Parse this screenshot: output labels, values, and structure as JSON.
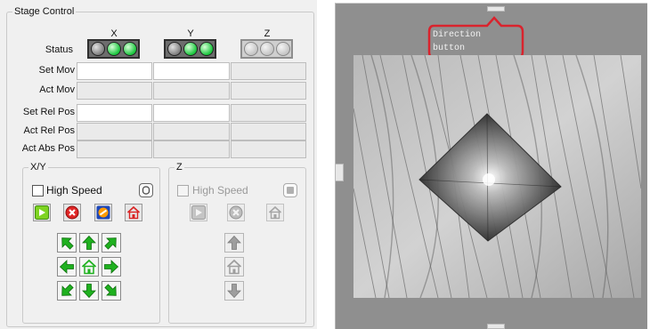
{
  "stage_control": {
    "title": "Stage Control",
    "axes": [
      "X",
      "Y",
      "Z"
    ],
    "status_label": "Status",
    "rows": [
      {
        "label": "Set Mov",
        "editable": [
          true,
          true,
          false
        ]
      },
      {
        "label": "Act Mov",
        "editable": [
          false,
          false,
          false
        ]
      },
      {
        "label": "Set Rel Pos",
        "editable": [
          true,
          true,
          false
        ]
      },
      {
        "label": "Act Rel Pos",
        "editable": [
          false,
          false,
          false
        ]
      },
      {
        "label": "Act Abs Pos",
        "editable": [
          false,
          false,
          false
        ]
      }
    ],
    "xy_group": {
      "title": "X/Y",
      "high_speed_label": "High Speed",
      "high_speed_checked": false
    },
    "z_group": {
      "title": "Z",
      "high_speed_label": "High Speed",
      "high_speed_checked": false,
      "enabled": false
    }
  },
  "camera_view": {
    "annotation": [
      "Direction",
      "button"
    ]
  },
  "colors": {
    "led_green": "#18c53c",
    "arrow_green": "#1fb11f",
    "annotation_red": "#d9232d"
  },
  "icons": {
    "start": "play-icon",
    "stop": "stop-icon",
    "calibrate": "calibrate-icon",
    "home": "home-icon",
    "arrows": [
      "arrow-up-left-icon",
      "arrow-up-icon",
      "arrow-up-right-icon",
      "arrow-left-icon",
      "home-icon",
      "arrow-right-icon",
      "arrow-down-left-icon",
      "arrow-down-icon",
      "arrow-down-right-icon"
    ]
  }
}
